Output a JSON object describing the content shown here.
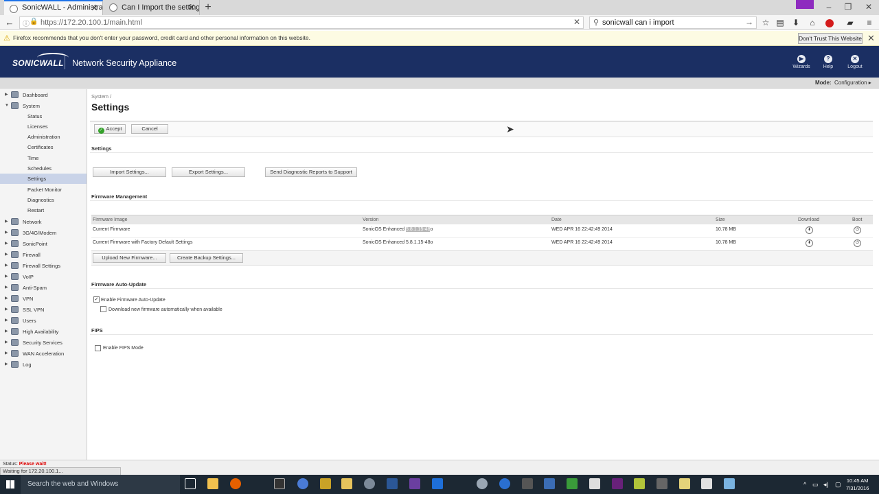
{
  "browser": {
    "tabs": [
      {
        "title": "SonicWALL - Administrati...",
        "active": true
      },
      {
        "title": "Can I Import the settings f...",
        "active": false
      }
    ],
    "url": "https://172.20.100.1/main.html",
    "search_query": "sonicwall can i import",
    "notification": "Firefox recommends that you don't enter your password, credit card and other personal information on this website.",
    "dont_trust_button": "Don't Trust This Website"
  },
  "header": {
    "logo": "SONICWALL",
    "title": "Network Security Appliance",
    "buttons": [
      "Wizards",
      "Help",
      "Logout"
    ]
  },
  "modebar": {
    "label": "Mode:",
    "value": "Configuration ▸"
  },
  "sidebar": {
    "items": [
      {
        "label": "Dashboard",
        "expanded": false
      },
      {
        "label": "System",
        "expanded": true
      },
      {
        "label": "Network",
        "expanded": false
      },
      {
        "label": "3G/4G/Modem",
        "expanded": false
      },
      {
        "label": "SonicPoint",
        "expanded": false
      },
      {
        "label": "Firewall",
        "expanded": false
      },
      {
        "label": "Firewall Settings",
        "expanded": false
      },
      {
        "label": "VoIP",
        "expanded": false
      },
      {
        "label": "Anti-Spam",
        "expanded": false
      },
      {
        "label": "VPN",
        "expanded": false
      },
      {
        "label": "SSL VPN",
        "expanded": false
      },
      {
        "label": "Users",
        "expanded": false
      },
      {
        "label": "High Availability",
        "expanded": false
      },
      {
        "label": "Security Services",
        "expanded": false
      },
      {
        "label": "WAN Acceleration",
        "expanded": false
      },
      {
        "label": "Log",
        "expanded": false
      }
    ],
    "system_subitems": [
      "Status",
      "Licenses",
      "Administration",
      "Certificates",
      "Time",
      "Schedules",
      "Settings",
      "Packet Monitor",
      "Diagnostics",
      "Restart"
    ],
    "selected": "Settings"
  },
  "main": {
    "breadcrumb": "System /",
    "title": "Settings",
    "accept_label": "Accept",
    "cancel_label": "Cancel",
    "settings_section": "Settings",
    "import_label": "Import Settings...",
    "export_label": "Export Settings...",
    "diag_label": "Send Diagnostic Reports to Support",
    "fw_section": "Firmware Management",
    "fw_columns": [
      "Firmware Image",
      "Version",
      "Date",
      "Size",
      "Download",
      "Boot"
    ],
    "fw_rows": [
      {
        "image": "Current Firmware",
        "version_prefix": "SonicOS Enhanced ",
        "version_highlight": "5.8.1.15-48",
        "version_suffix": "o",
        "date": "WED APR 16 22:42:49 2014",
        "size": "10.78 MB"
      },
      {
        "image": "Current Firmware with Factory Default Settings",
        "version_prefix": "SonicOS Enhanced 5.8.1.15-48o",
        "version_highlight": "",
        "version_suffix": "",
        "date": "WED APR 16 22:42:49 2014",
        "size": "10.78 MB"
      }
    ],
    "upload_label": "Upload New Firmware...",
    "backup_label": "Create Backup Settings...",
    "autoupdate_section": "Firmware Auto-Update",
    "enable_autoupdate_label": "Enable Firmware Auto-Update",
    "enable_autoupdate_checked": true,
    "download_auto_label": "Download new firmware automatically when available",
    "download_auto_checked": false,
    "fips_section": "FIPS",
    "fips_label": "Enable FIPS Mode",
    "fips_checked": false
  },
  "status": {
    "line1_prefix": "Status:",
    "line1_value": "Please wait!",
    "line2": "Waiting for 172.20.100.1..."
  },
  "taskbar": {
    "search_placeholder": "Search the web and Windows",
    "time": "10:45 AM",
    "date": "7/31/2016"
  }
}
